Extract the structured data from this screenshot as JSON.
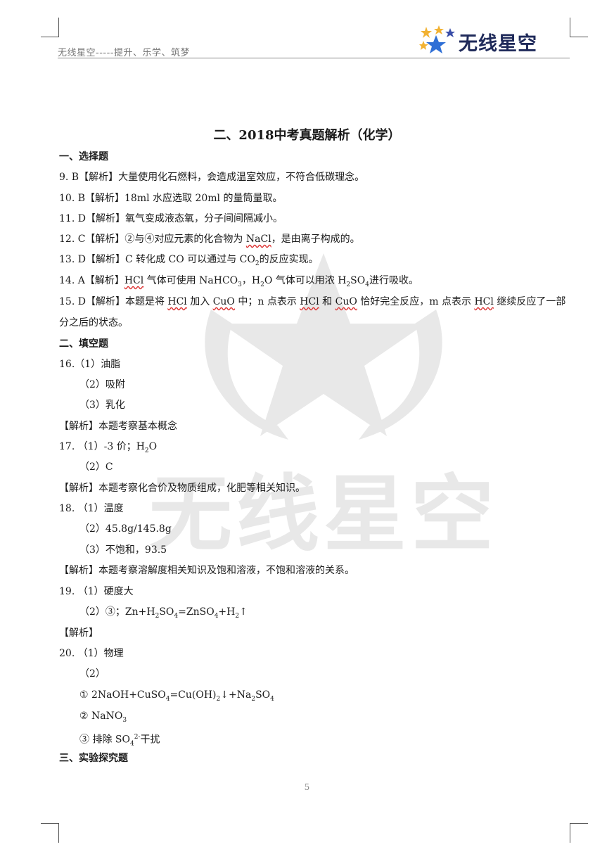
{
  "header": {
    "slogan": "无线星空-----提升、乐学、筑梦",
    "logo_text": "无线星空"
  },
  "watermark": {
    "text": "无线星空"
  },
  "title": "二、2018中考真题解析（化学）",
  "sections": {
    "choice": "一、选择题",
    "fill": "二、填空题",
    "experiment": "三、实验探究题"
  },
  "q9": "9. B【解析】大量使用化石燃料，会造成温室效应，不符合低碳理念。",
  "q10": "10. B【解析】18ml 水应选取 20ml 的量筒量取。",
  "q11": "11. D【解析】氧气变成液态氧，分子间间隔减小。",
  "q12": {
    "pre": "12. C【解析】②与④对应元素的化合物为 ",
    "term": "NaCl",
    "post": "，是由离子构成的。"
  },
  "q13": {
    "pre": "13. D【解析】C 转化成 CO 可以通过与 CO",
    "sub": "2",
    "post": "的反应实现。"
  },
  "q14": {
    "pre": "14. A【解析】",
    "term": "HCl",
    "mid1": " 气体可使用 NaHCO",
    "sub1": "3",
    "mid2": "，H",
    "sub2": "2",
    "mid3": "O 气体可以用浓 H",
    "sub3": "2",
    "mid4": "SO",
    "sub4": "4",
    "post": "进行吸收。"
  },
  "q15": {
    "pre": "15. D【解析】本题是将 ",
    "term1": "HCl",
    "mid1": " 加入 ",
    "term2": "CuO",
    "mid2": " 中；n 点表示 ",
    "term3": "HCl",
    "mid3": " 和 ",
    "term4": "CuO",
    "mid4": " 恰好完全反应，m 点表示 ",
    "term5": "HCl",
    "post": " 继续反应了一部",
    "line2": "分之后的状态。"
  },
  "q16": {
    "a1": "16.（1）油脂",
    "a2": "（2）吸附",
    "a3": "（3）乳化",
    "analysis": "【解析】本题考察基本概念"
  },
  "q17": {
    "a1_pre": "17. （1）-3 价；H",
    "a1_sub": "2",
    "a1_post": "O",
    "a2": "（2）C",
    "analysis": "【解析】本题考察化合价及物质组成，化肥等相关知识。"
  },
  "q18": {
    "a1": "18. （1）温度",
    "a2": "（2）45.8g/145.8g",
    "a3": "（3）不饱和，93.5",
    "analysis": "【解析】本题考察溶解度相关知识及饱和溶液，不饱和溶液的关系。"
  },
  "q19": {
    "a1": "19. （1）硬度大",
    "a2_pre": "（2）③；Zn+H",
    "a2_s1": "2",
    "a2_m1": "SO",
    "a2_s2": "4",
    "a2_m2": "=ZnSO",
    "a2_s3": "4",
    "a2_m3": "+H",
    "a2_s4": "2",
    "a2_post": "↑",
    "analysis": "【解析】"
  },
  "q20": {
    "a1": "20. （1）物理",
    "a2": "（2）",
    "r1_pre": "①  2NaOH+CuSO",
    "r1_s1": "4",
    "r1_m1": "=Cu(OH)",
    "r1_s2": "2",
    "r1_m2": "↓+Na",
    "r1_s3": "2",
    "r1_m3": "SO",
    "r1_s4": "4",
    "r2_pre": "②  NaNO",
    "r2_s1": "3",
    "r3_pre": "③  排除 SO",
    "r3_sub": "4",
    "r3_sup": "2-",
    "r3_post": "干扰"
  },
  "page_number": "5",
  "colors": {
    "logo_navy": "#1f2a5a",
    "star_gold": "#f2b233",
    "star_blue": "#2f6fd6",
    "wavy_red": "#d33"
  }
}
